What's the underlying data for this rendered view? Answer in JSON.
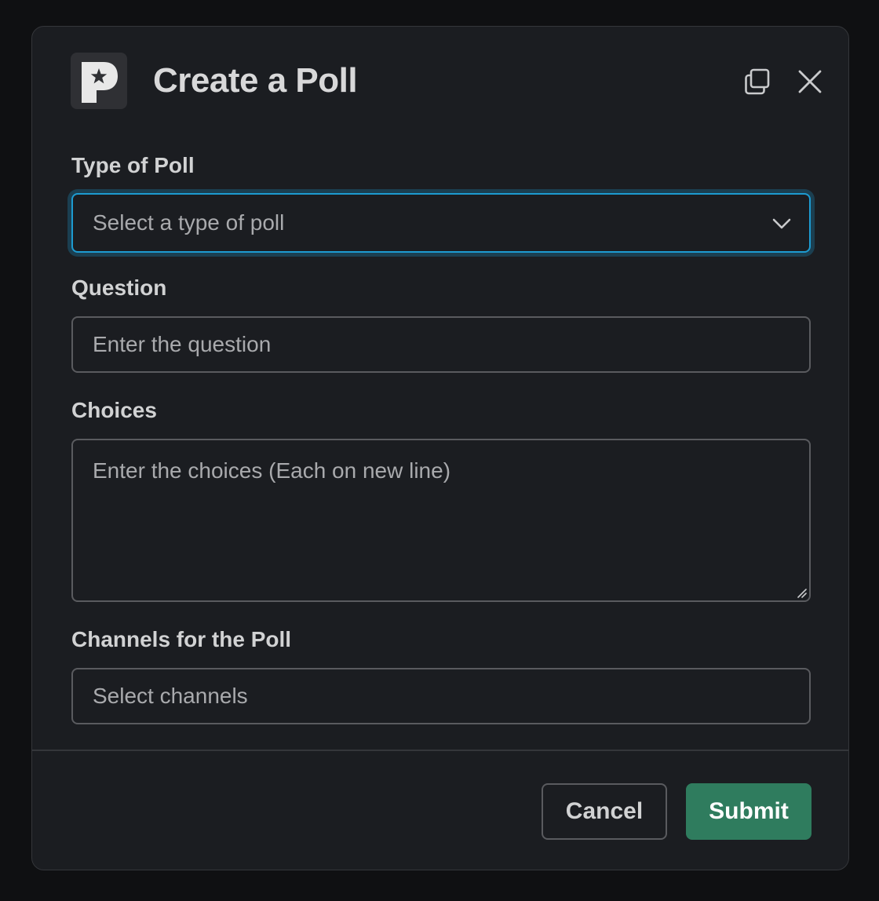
{
  "modal": {
    "title": "Create a Poll",
    "accent_color": "#1d9bd1",
    "submit_color": "#2f7c5e"
  },
  "header": {
    "app_icon": "poll-app-icon",
    "popout_icon": "popout-icon",
    "close_icon": "close-icon"
  },
  "fields": {
    "poll_type": {
      "label": "Type of Poll",
      "placeholder": "Select a type of poll",
      "icon": "chevron-down-icon"
    },
    "question": {
      "label": "Question",
      "placeholder": "Enter the question"
    },
    "choices": {
      "label": "Choices",
      "placeholder": "Enter the choices (Each on new line)"
    },
    "channels": {
      "label": "Channels for the Poll",
      "placeholder": "Select channels"
    }
  },
  "footer": {
    "cancel_label": "Cancel",
    "submit_label": "Submit"
  }
}
